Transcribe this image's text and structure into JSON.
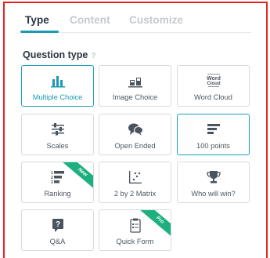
{
  "tabs": [
    {
      "label": "Type",
      "active": true
    },
    {
      "label": "Content",
      "active": false
    },
    {
      "label": "Customize",
      "active": false
    }
  ],
  "section": {
    "title": "Question type",
    "help": "?"
  },
  "cards": [
    {
      "label": "Multiple Choice",
      "icon": "bar-chart-icon",
      "selected": true
    },
    {
      "label": "Image Choice",
      "icon": "image-choice-icon",
      "selected": false
    },
    {
      "label": "Word Cloud",
      "icon": "word-cloud-icon",
      "selected": false,
      "icon_text": [
        "Word",
        "Cloud"
      ]
    },
    {
      "label": "Scales",
      "icon": "sliders-icon",
      "selected": false
    },
    {
      "label": "Open Ended",
      "icon": "speech-bubbles-icon",
      "selected": false
    },
    {
      "label": "100 points",
      "icon": "stacked-lines-icon",
      "selected": true
    },
    {
      "label": "Ranking",
      "icon": "ranking-icon",
      "selected": false,
      "badge": "New"
    },
    {
      "label": "2 by 2 Matrix",
      "icon": "matrix-scatter-icon",
      "selected": false
    },
    {
      "label": "Who will win?",
      "icon": "trophy-icon",
      "selected": false
    },
    {
      "label": "Q&A",
      "icon": "qa-icon",
      "selected": false
    },
    {
      "label": "Quick Form",
      "icon": "clipboard-form-icon",
      "selected": false,
      "badge": "Pro"
    }
  ],
  "colors": {
    "accent": "#1a9ab2",
    "badge": "#1db07d",
    "frame": "#e8211d",
    "icon": "#4a545e"
  }
}
